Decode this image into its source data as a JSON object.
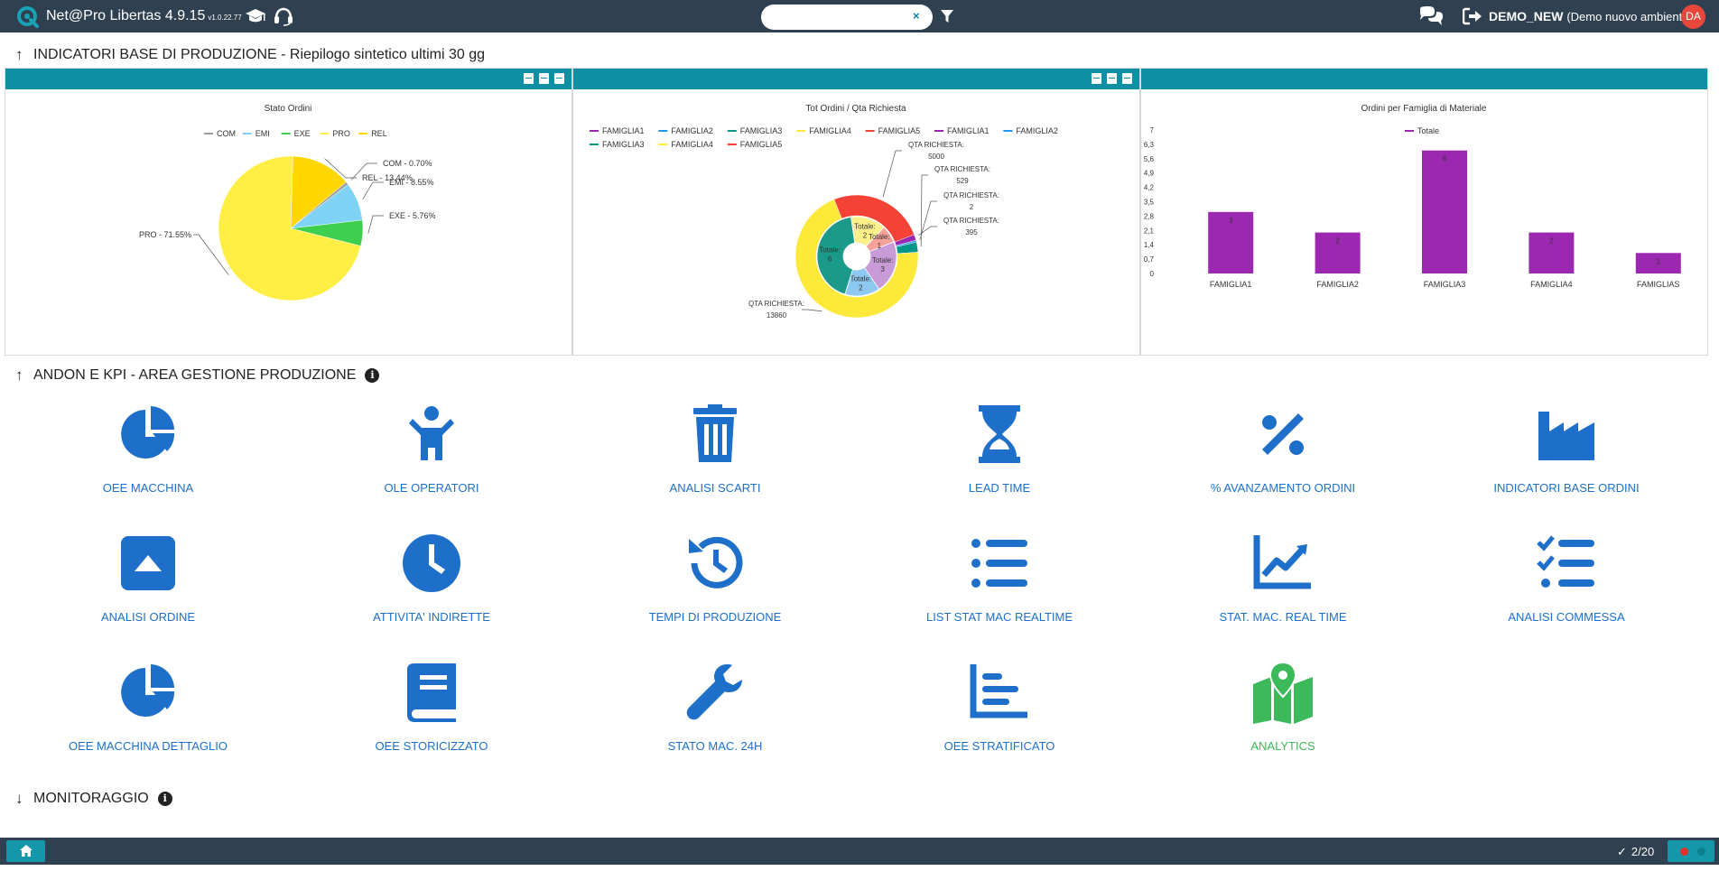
{
  "app": {
    "title": "Net@Pro Libertas 4.9.15",
    "version": "v1.0.22.77",
    "search_value": "",
    "search_clear": "×",
    "env_code": "DEMO_NEW",
    "env_desc": "(Demo nuovo ambiente)",
    "avatar": "DA",
    "accent": "#0e8fa3",
    "topbar_color": "#2f4050"
  },
  "icons": {
    "logo": "app-logo-icon",
    "training": "graduation-cap-icon",
    "support": "headset-icon",
    "filter": "filter-icon",
    "chat": "chat-icon",
    "logout": "logout-icon"
  },
  "section1": {
    "arrow": "↑",
    "title": "INDICATORI BASE DI PRODUZIONE - Riepilogo sintetico ultimi 30 gg"
  },
  "section2": {
    "arrow": "↑",
    "title": "ANDON E KPI - AREA GESTIONE PRODUZIONE",
    "info": "i"
  },
  "section3": {
    "arrow": "↓",
    "title": "MONITORAGGIO",
    "info": "i"
  },
  "chart_data": [
    {
      "type": "pie",
      "title": "Stato Ordini",
      "legend": [
        "COM",
        "EMI",
        "EXE",
        "PRO",
        "REL"
      ],
      "colors": [
        "#9e9e9e",
        "#7fd3f7",
        "#3ecf4f",
        "#ffee44",
        "#ffd600"
      ],
      "slices": [
        {
          "name": "COM",
          "value": 0.7,
          "label": "COM - 0.70%",
          "color": "#a0a0a0"
        },
        {
          "name": "EMI",
          "value": 8.55,
          "label": "EMI - 8.55%",
          "color": "#7fd3f7"
        },
        {
          "name": "EXE",
          "value": 5.76,
          "label": "EXE - 5.76%",
          "color": "#3ecf4f"
        },
        {
          "name": "PRO",
          "value": 71.55,
          "label": "PRO - 71.55%",
          "color": "#ffee44"
        },
        {
          "name": "REL",
          "value": 13.44,
          "label": "REL - 13.44%",
          "color": "#ffd600"
        }
      ],
      "legend_position": "top"
    },
    {
      "type": "pie",
      "title": "Tot Ordini / Qta Richiesta",
      "legend": [
        "FAMIGLIA1",
        "FAMIGLIA2",
        "FAMIGLIA3",
        "FAMIGLIA4",
        "FAMIGLIA5",
        "FAMIGLIA1",
        "FAMIGLIA2",
        "FAMIGLIA3",
        "FAMIGLIA4",
        "FAMIGLIA5"
      ],
      "legend_colors": [
        "#9c27b0",
        "#2196f3",
        "#009688",
        "#ffeb3b",
        "#f44336",
        "#9c27b0",
        "#2196f3",
        "#009688",
        "#ffeb3b",
        "#f44336"
      ],
      "outer_ring": [
        {
          "name": "FAMIGLIA1",
          "value": 395,
          "label_line1": "QTA RICHIESTA:",
          "label_line2": "395",
          "color": "#9c27b0"
        },
        {
          "name": "FAMIGLIA2",
          "value": 2,
          "label_line1": "QTA RICHIESTA:",
          "label_line2": "2",
          "color": "#2196f3"
        },
        {
          "name": "FAMIGLIA3",
          "value": 529,
          "label_line1": "QTA RICHIESTA:",
          "label_line2": "529",
          "color": "#009688"
        },
        {
          "name": "FAMIGLIA4",
          "value": 13860,
          "label_line1": "QTA RICHIESTA:",
          "label_line2": "13860",
          "color": "#fde93a"
        },
        {
          "name": "FAMIGLIA5",
          "value": 5000,
          "label_line1": "QTA RICHIESTA:",
          "label_line2": "5000",
          "color": "#f44336"
        }
      ],
      "inner_ring": [
        {
          "name": "FAMIGLIA1",
          "value": 3,
          "label": "Totale: 3",
          "color": "#c89bd6"
        },
        {
          "name": "FAMIGLIA2",
          "value": 2,
          "label": "Totale: 2",
          "color": "#8cc8f2"
        },
        {
          "name": "FAMIGLIA3",
          "value": 6,
          "label": "Totale: 6",
          "color": "#1b9a8a"
        },
        {
          "name": "FAMIGLIA4",
          "value": 2,
          "label": "Totale: 2",
          "color": "#fdf08a"
        },
        {
          "name": "FAMIGLIA5",
          "value": 1,
          "label": "Totale: 1",
          "color": "#f6a29b"
        }
      ],
      "legend_position": "top"
    },
    {
      "type": "bar",
      "title": "Ordini per Famiglia di Materiale",
      "categories": [
        "FAMIGLIA1",
        "FAMIGLIA2",
        "FAMIGLIA3",
        "FAMIGLIA4",
        "FAMIGLIA5"
      ],
      "series": [
        {
          "name": "Totale",
          "values": [
            3,
            2,
            6,
            2,
            1
          ],
          "color": "#9c27b0"
        }
      ],
      "yticks": [
        "0",
        "0,7",
        "1,4",
        "2,1",
        "2,8",
        "3,5",
        "4,2",
        "4,9",
        "5,6",
        "6,3",
        "7"
      ],
      "ylim": [
        0,
        7
      ],
      "category_labels": [
        "FAMIGLIA1",
        "FAMIGLIA2",
        "FAMIGLIA3",
        "FAMIGLIA4",
        "FAMIGLIAS"
      ],
      "legend_position": "top"
    }
  ],
  "tiles": [
    {
      "label": "OEE MACCHINA",
      "icon": "pie-chart-icon"
    },
    {
      "label": "OLE OPERATORI",
      "icon": "child-figure-icon"
    },
    {
      "label": "ANALISI SCARTI",
      "icon": "trash-icon"
    },
    {
      "label": "LEAD TIME",
      "icon": "hourglass-icon"
    },
    {
      "label": "% AVANZAMENTO ORDINI",
      "icon": "percent-icon"
    },
    {
      "label": "INDICATORI BASE ORDINI",
      "icon": "factory-icon"
    },
    {
      "label": "ANALISI ORDINE",
      "icon": "caret-square-up-icon"
    },
    {
      "label": "ATTIVITA' INDIRETTE",
      "icon": "clock-icon"
    },
    {
      "label": "TEMPI DI PRODUZIONE",
      "icon": "history-icon"
    },
    {
      "label": "LIST STAT MAC REALTIME",
      "icon": "list-icon"
    },
    {
      "label": "STAT. MAC. REAL TIME",
      "icon": "line-chart-icon"
    },
    {
      "label": "ANALISI COMMESSA",
      "icon": "checklist-icon"
    },
    {
      "label": "OEE MACCHINA DETTAGLIO",
      "icon": "pie-chart-icon"
    },
    {
      "label": "OEE STORICIZZATO",
      "icon": "book-icon"
    },
    {
      "label": "STATO MAC. 24H",
      "icon": "wrench-icon"
    },
    {
      "label": "OEE STRATIFICATO",
      "icon": "bar-chart-horizontal-icon"
    },
    {
      "label": "ANALYTICS",
      "icon": "map-marker-icon",
      "color": "#3cb95a"
    }
  ],
  "bottom": {
    "home": "home-icon",
    "check": "✓",
    "counter": "2/20"
  }
}
